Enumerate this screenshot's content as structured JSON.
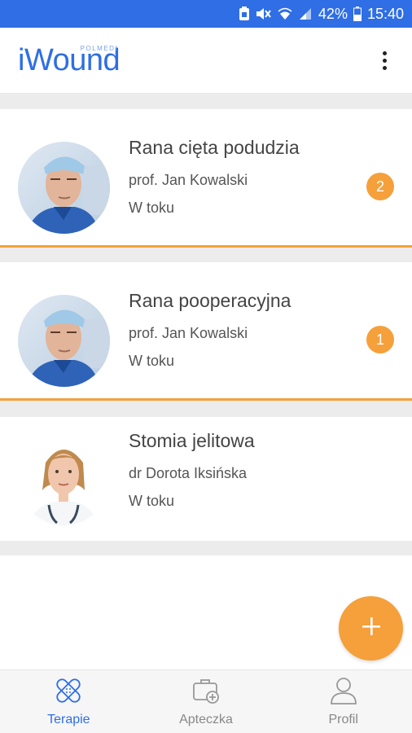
{
  "status_bar": {
    "battery_percent": "42%",
    "time": "15:40",
    "icons": [
      "notification-icon",
      "mute-icon",
      "wifi-icon",
      "signal-icon",
      "battery-icon"
    ]
  },
  "app_bar": {
    "logo_main": "iWound",
    "logo_sub": "POLMEDI",
    "menu_icon": "more-vert-icon"
  },
  "therapies": [
    {
      "title": "Rana cięta podudzia",
      "doctor": "prof. Jan Kowalski",
      "status": "W toku",
      "badge": "2",
      "avatar": "male-surgeon"
    },
    {
      "title": "Rana pooperacyjna",
      "doctor": "prof. Jan Kowalski",
      "status": "W toku",
      "badge": "1",
      "avatar": "male-surgeon"
    },
    {
      "title": "Stomia jelitowa",
      "doctor": "dr Dorota Iksińska",
      "status": "W toku",
      "badge": "",
      "avatar": "female-doctor"
    }
  ],
  "fab": {
    "icon": "plus-icon"
  },
  "bottom_nav": {
    "items": [
      {
        "label": "Terapie",
        "icon": "bandage-icon",
        "active": true
      },
      {
        "label": "Apteczka",
        "icon": "first-aid-kit-icon",
        "active": false
      },
      {
        "label": "Profil",
        "icon": "user-icon",
        "active": false
      }
    ]
  },
  "colors": {
    "primary": "#2f6ee4",
    "accent": "#f5a03a",
    "divider": "#ececec"
  }
}
